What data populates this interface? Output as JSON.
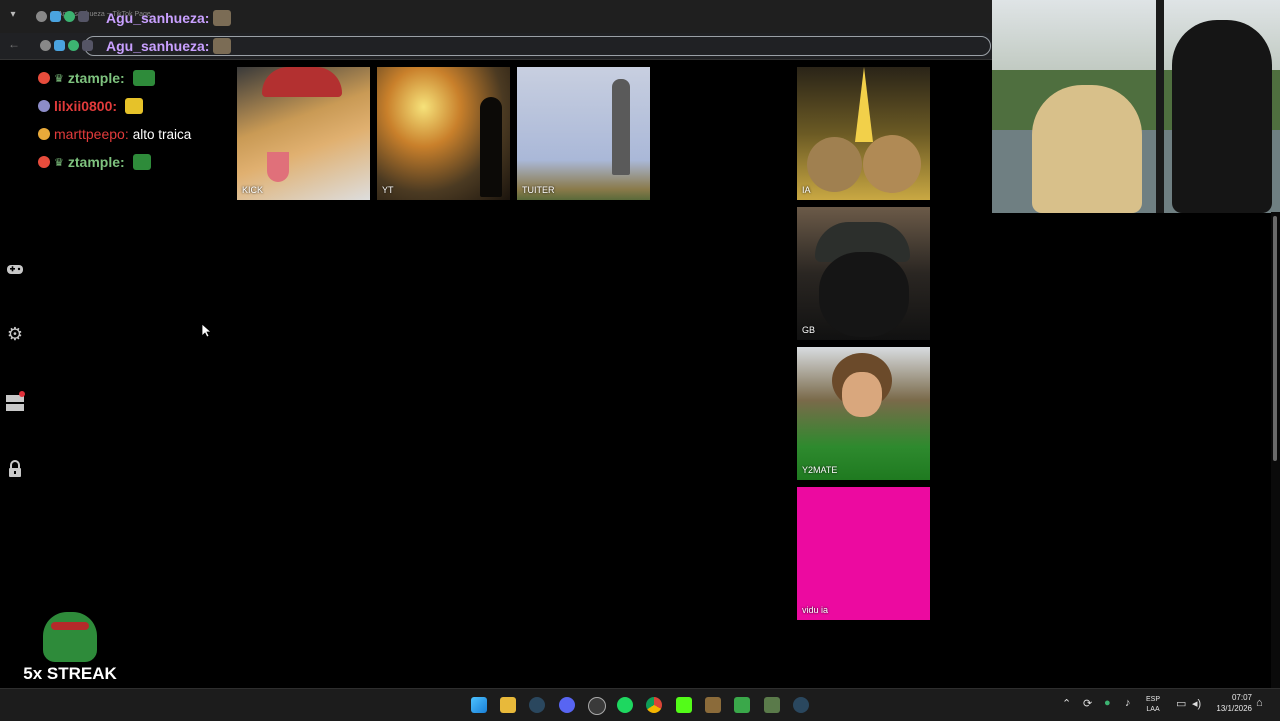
{
  "browser": {
    "tab_title": "Agu_sanhueza ~ TikTok Page",
    "tab_dropdown_icon": "chevron-down-icon",
    "back_icon": "arrow-left-icon"
  },
  "overlay": {
    "top_user_1": "Agu_sanhueza:",
    "top_user_2": "Agu_sanhueza:"
  },
  "chat": [
    {
      "user": "ztample:",
      "message": "",
      "user_color": "#7ec27e",
      "dot_color": "#e74c3c"
    },
    {
      "user": "lilxii0800:",
      "message": "",
      "user_color": "#e23b3b",
      "dot_color": "#8c8cc8"
    },
    {
      "user": "marttpeepo:",
      "message": "alto traica",
      "user_color": "#e23b3b",
      "dot_color": "#e8a93a"
    },
    {
      "user": "ztample:",
      "message": "",
      "user_color": "#7ec27e",
      "dot_color": "#e74c3c"
    }
  ],
  "sidebar": {
    "icons": [
      "gamepad-icon",
      "gear-icon",
      "layers-notification-icon",
      "lock-icon"
    ]
  },
  "tiles": [
    {
      "label": "KICK"
    },
    {
      "label": "YT"
    },
    {
      "label": "TUITER"
    },
    {
      "label": "IA"
    },
    {
      "label": "GB"
    },
    {
      "label": "Y2MATE"
    },
    {
      "label": "vidu ia"
    }
  ],
  "streak": {
    "text": "5x STREAK"
  },
  "taskbar": {
    "apps": [
      "windows-start-icon",
      "file-explorer-icon",
      "steam-icon",
      "discord-icon",
      "obs-icon",
      "spotify-icon",
      "chrome-icon",
      "kick-icon",
      "minecraft-icon",
      "launcher-icon",
      "app-icon",
      "steam-icon"
    ],
    "lang_top": "ESP",
    "lang_bottom": "LAA",
    "time": "07:07",
    "date": "13/1/2026"
  },
  "colors": {
    "pink_tile": "#ec0aa0",
    "chat_green": "#7ec27e",
    "chat_red": "#e23b3b"
  }
}
